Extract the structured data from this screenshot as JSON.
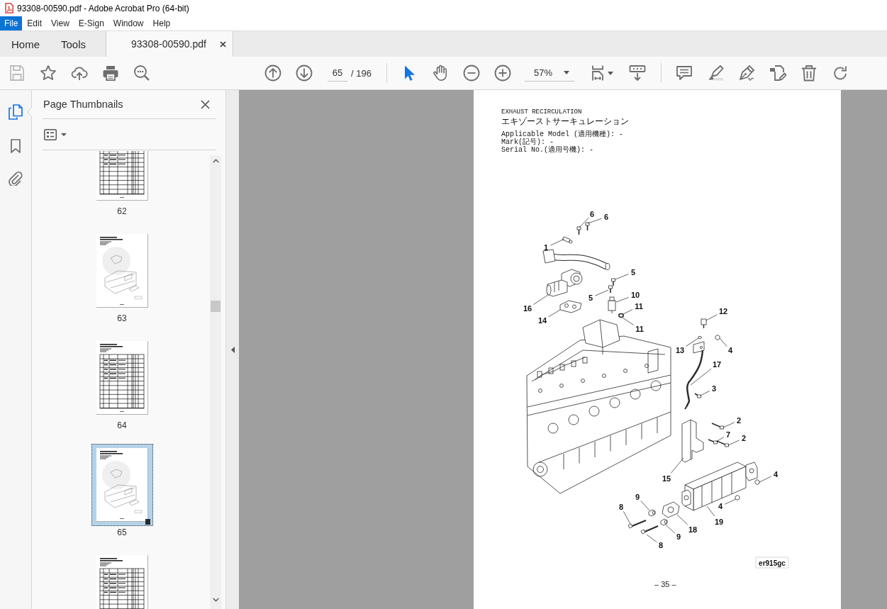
{
  "window": {
    "title": "93308-00590.pdf - Adobe Acrobat Pro (64-bit)"
  },
  "menu_bar": [
    {
      "label": "File",
      "selected": true
    },
    {
      "label": "Edit",
      "selected": false
    },
    {
      "label": "View",
      "selected": false
    },
    {
      "label": "E-Sign",
      "selected": false
    },
    {
      "label": "Window",
      "selected": false
    },
    {
      "label": "Help",
      "selected": false
    }
  ],
  "tabs": [
    {
      "label": "Home",
      "kind": "nav",
      "selected": false
    },
    {
      "label": "Tools",
      "kind": "nav",
      "selected": false
    },
    {
      "label": "93308-00590.pdf",
      "kind": "document",
      "selected": true
    }
  ],
  "toolbar": {
    "save": {
      "disabled": true
    },
    "page": {
      "value": "65",
      "total": "/ 196"
    },
    "pointer_tools": [
      {
        "selected": true
      },
      {
        "selected": false
      }
    ],
    "zoom": {
      "value": "57%"
    }
  },
  "sidebar": {
    "rail": [
      {
        "selected": true
      },
      {
        "selected": false
      },
      {
        "selected": false
      }
    ],
    "panel": {
      "title": "Page Thumbnails"
    },
    "thumbnails": [
      {
        "page": "62",
        "kind": "table",
        "selected": false
      },
      {
        "page": "63",
        "kind": "drawing",
        "selected": false
      },
      {
        "page": "64",
        "kind": "table",
        "selected": false
      },
      {
        "page": "65",
        "kind": "drawing",
        "selected": true
      },
      {
        "kind": "table",
        "selected": false
      }
    ]
  },
  "document": {
    "title": "EXHAUST RECIRCULATION",
    "title_ja": "エキゾーストサーキュレーション",
    "fields": [
      "Applicable Model (適用機種): -",
      "Mark(記号): -",
      "Serial No.(適用号機): -"
    ],
    "figure": {
      "callouts": [
        "6",
        "6",
        "1",
        "5",
        "10",
        "5",
        "11",
        "16",
        "12",
        "14",
        "11",
        "13",
        "4",
        "17",
        "3",
        "2",
        "7",
        "2",
        "4",
        "15",
        "9",
        "4",
        "8",
        "19",
        "18",
        "9",
        "8"
      ],
      "figure_id": "er915gc"
    },
    "page_number": "– 35 –"
  }
}
